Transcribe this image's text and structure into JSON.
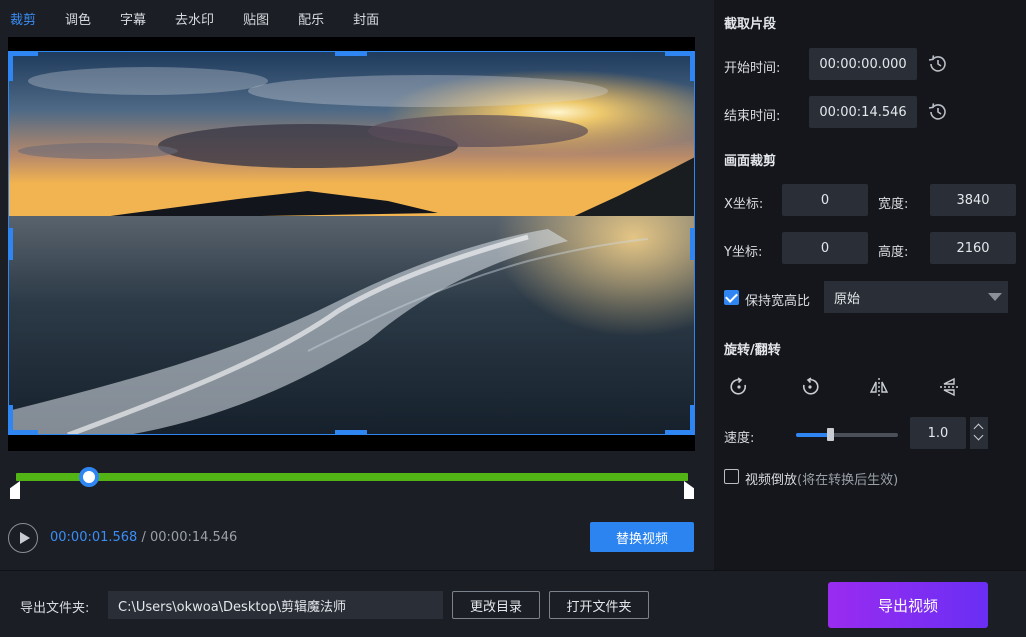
{
  "tabs": [
    {
      "label": "裁剪",
      "active": true
    },
    {
      "label": "调色",
      "active": false
    },
    {
      "label": "字幕",
      "active": false
    },
    {
      "label": "去水印",
      "active": false
    },
    {
      "label": "贴图",
      "active": false
    },
    {
      "label": "配乐",
      "active": false
    },
    {
      "label": "封面",
      "active": false
    }
  ],
  "timeline": {
    "position_fraction": 0.108
  },
  "player": {
    "current_time": "00:00:01.568",
    "separator": " / ",
    "total_time": "00:00:14.546",
    "replace_label": "替换视频"
  },
  "clip": {
    "title": "截取片段",
    "start_label": "开始时间:",
    "start_value": "00:00:00.000",
    "end_label": "结束时间:",
    "end_value": "00:00:14.546"
  },
  "crop": {
    "title": "画面裁剪",
    "x_label": "X坐标:",
    "x_value": "0",
    "y_label": "Y坐标:",
    "y_value": "0",
    "width_label": "宽度:",
    "width_value": "3840",
    "height_label": "高度:",
    "height_value": "2160",
    "keep_ratio_label": "保持宽高比",
    "keep_ratio_checked": true,
    "ratio_value": "原始"
  },
  "rotate": {
    "title": "旋转/翻转",
    "icons": [
      "rotate-clockwise-icon",
      "rotate-counterclockwise-icon",
      "flip-horizontal-icon",
      "flip-vertical-icon"
    ]
  },
  "speed": {
    "label": "速度:",
    "value": "1.0",
    "slider_fraction": 0.33
  },
  "reverse": {
    "label": "视频倒放",
    "hint": "(将在转换后生效)",
    "checked": false
  },
  "bottom": {
    "folder_label": "导出文件夹:",
    "folder_path": "C:\\Users\\okwoa\\Desktop\\剪辑魔法师",
    "change_dir_label": "更改目录",
    "open_folder_label": "打开文件夹",
    "export_label": "导出视频"
  },
  "colors": {
    "accent": "#2f86f2",
    "track": "#52b515",
    "export_from": "#9a2cf0",
    "export_to": "#6a2ef4"
  }
}
